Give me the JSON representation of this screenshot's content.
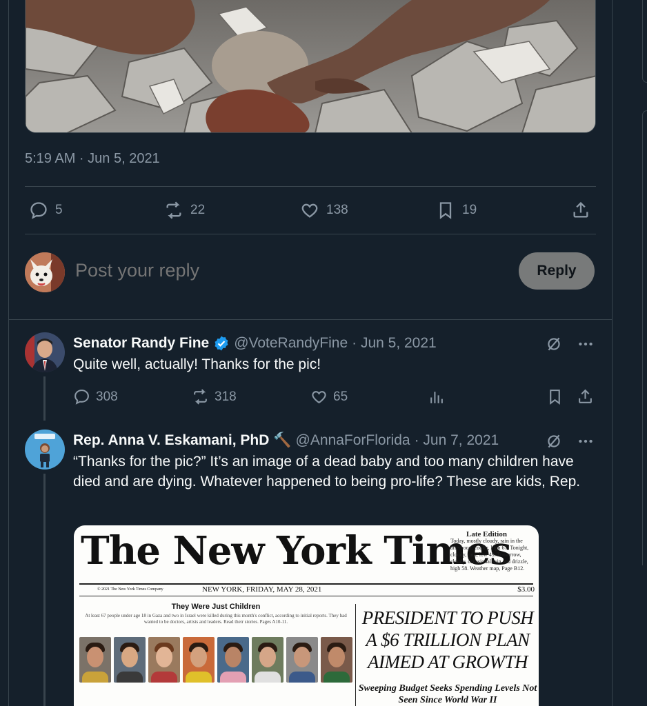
{
  "main_tweet": {
    "timestamp": "5:19 AM · Jun 5, 2021",
    "stats": {
      "replies": "5",
      "reposts": "22",
      "likes": "138",
      "bookmarks": "19"
    }
  },
  "reply_box": {
    "placeholder": "Post your reply",
    "button_label": "Reply"
  },
  "replies": [
    {
      "name": "Senator Randy Fine",
      "handle": "@VoteRandyFine",
      "date": "· Jun 5, 2021",
      "text": "Quite well, actually!  Thanks for the pic!",
      "stats": {
        "replies": "308",
        "reposts": "318",
        "likes": "65"
      }
    },
    {
      "name": "Rep. Anna V. Eskamani, PhD",
      "name_emoji": "🔨",
      "handle": "@AnnaForFlorida",
      "date": "· Jun 7, 2021",
      "text": "“Thanks for the pic?” It’s an image of a dead baby and too many children have died and are dying. Whatever happened to being pro-life? These are kids, Rep."
    }
  ],
  "newspaper": {
    "masthead": "The New York Times",
    "edition_title": "Late Edition",
    "edition_text": "Today, mostly cloudy, rain in the afternoon, cooler, high 67. Tonight, cloudy, rain, low 49. Tomorrow, cloudy, occasional rain and drizzle, high 58. Weather map, Page B12.",
    "copyright": "© 2021 The New York Times Company",
    "dateline": "NEW YORK, FRIDAY, MAY 28, 2021",
    "price": "$3.00",
    "feature_title": "They Were Just Children",
    "feature_sub": "At least 67 people under age 18 in Gaza and two in Israel were killed during this month's conflict, according to initial reports. They had wanted to be doctors, artists and leaders. Read their stories. Pages A10-11.",
    "headline": "PRESIDENT TO PUSH A $6 TRILLION PLAN AIMED AT GROWTH",
    "subhead": "Sweeping Budget Seeks Spending Levels Not Seen Since World War II"
  },
  "colors": {
    "background": "#15202b",
    "border": "#38444d",
    "muted_text": "#8b98a5",
    "verified_blue": "#1d9bf0",
    "reply_button": "#787a7a"
  }
}
